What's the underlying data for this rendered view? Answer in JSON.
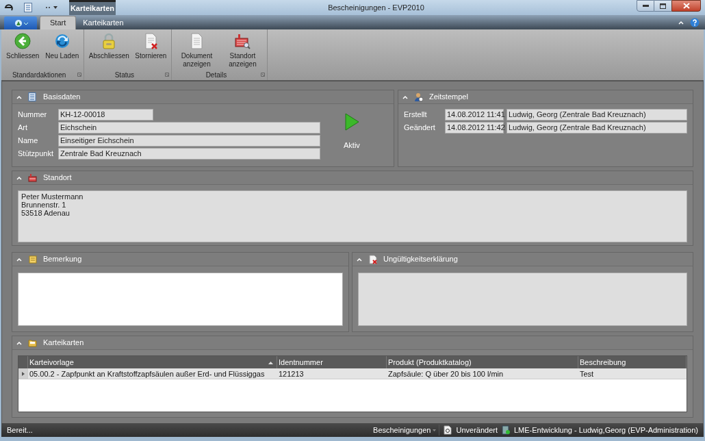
{
  "window": {
    "title": "Bescheinigungen - EVP2010",
    "context_tab": "Karteikarten"
  },
  "tabs": [
    {
      "label": "Start",
      "selected": true
    },
    {
      "label": "Karteikarten",
      "selected": false
    }
  ],
  "ribbon_groups": [
    {
      "label": "Standardaktionen",
      "buttons": [
        "Schliessen",
        "Neu Laden"
      ]
    },
    {
      "label": "Status",
      "buttons": [
        "Abschliessen",
        "Stornieren"
      ]
    },
    {
      "label": "Details",
      "buttons": [
        "Dokument anzeigen",
        "Standort anzeigen"
      ]
    }
  ],
  "basisdaten": {
    "title": "Basisdaten",
    "fields": [
      {
        "label": "Nummer",
        "value": "KH-12-00018",
        "kind": "short"
      },
      {
        "label": "Art",
        "value": "Eichschein",
        "kind": "long"
      },
      {
        "label": "Name",
        "value": "Einseitiger Eichschein",
        "kind": "long"
      },
      {
        "label": "Stützpunkt",
        "value": "Zentrale Bad Kreuznach",
        "kind": "long"
      }
    ],
    "status": "Aktiv"
  },
  "zeitstempel": {
    "title": "Zeitstempel",
    "rows": [
      {
        "label": "Erstellt",
        "date": "14.08.2012 11:41",
        "user": "Ludwig, Georg (Zentrale Bad Kreuznach)"
      },
      {
        "label": "Geändert",
        "date": "14.08.2012 11:42",
        "user": "Ludwig, Georg (Zentrale Bad Kreuznach)"
      }
    ]
  },
  "standort": {
    "title": "Standort",
    "lines": [
      "Peter Mustermann",
      "Brunnenstr. 1",
      "53518 Adenau"
    ]
  },
  "bemerkung": {
    "title": "Bemerkung"
  },
  "ungueltigkeit": {
    "title": "Ungültigkeitserklärung"
  },
  "karteikarten": {
    "title": "Karteikarten",
    "columns": [
      {
        "label": "Karteivorlage",
        "sorted": true
      },
      {
        "label": "Identnummer",
        "sorted": false
      },
      {
        "label": "Produkt (Produktkatalog)",
        "sorted": false
      },
      {
        "label": "Beschreibung",
        "sorted": false
      }
    ],
    "rows": [
      {
        "cells": [
          "05.00.2 - Zapfpunkt an Kraftstoffzapfsäulen außer Erd- und Flüssiggas",
          "121213",
          "Zapfsäule: Q über 20 bis 100 l/min",
          "Test"
        ],
        "selected": true
      }
    ]
  },
  "status_bar": {
    "message": "Bereit...",
    "module": "Bescheinigungen",
    "state": "Unverändert",
    "user": "LME-Entwicklung - Ludwig,Georg (EVP-Administration)"
  }
}
